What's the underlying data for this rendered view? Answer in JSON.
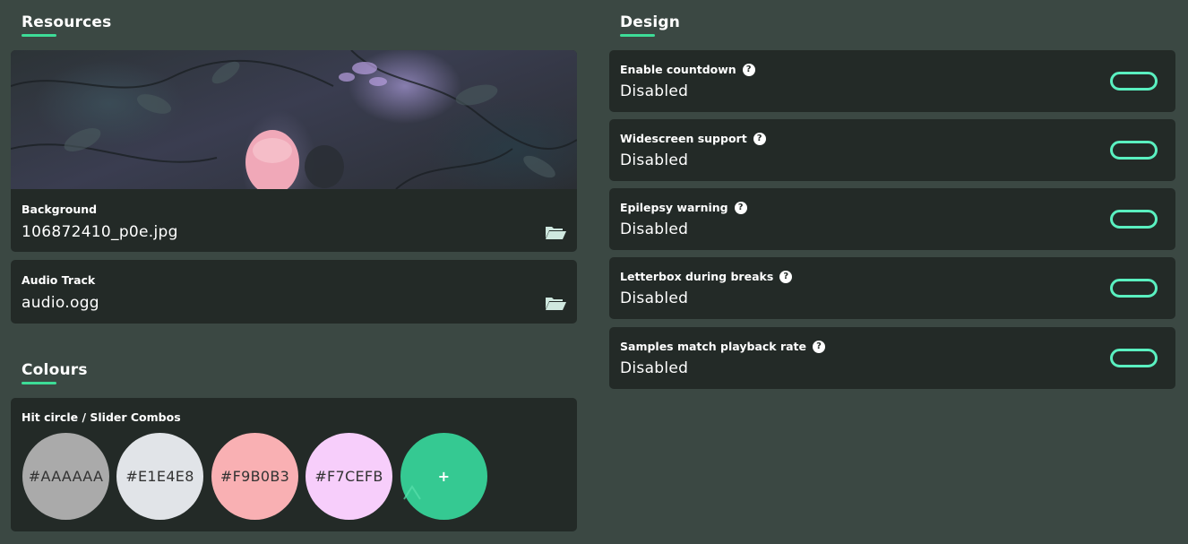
{
  "resources": {
    "title": "Resources",
    "background": {
      "label": "Background",
      "value": "106872410_p0e.jpg",
      "icon": "folder-open-icon"
    },
    "audio": {
      "label": "Audio Track",
      "value": "audio.ogg",
      "icon": "folder-open-icon"
    }
  },
  "colours": {
    "title": "Colours",
    "label": "Hit circle / Slider Combos",
    "swatches": [
      {
        "hex": "#AAAAAA",
        "label": "#AAAAAA"
      },
      {
        "hex": "#E1E4E8",
        "label": "#E1E4E8"
      },
      {
        "hex": "#F9B0B3",
        "label": "#F9B0B3"
      },
      {
        "hex": "#F7CEFB",
        "label": "#F7CEFB"
      }
    ],
    "add_label": "+",
    "add_color": "#35c992"
  },
  "design": {
    "title": "Design",
    "settings": [
      {
        "label": "Enable countdown",
        "value": "Disabled"
      },
      {
        "label": "Widescreen support",
        "value": "Disabled"
      },
      {
        "label": "Epilepsy warning",
        "value": "Disabled"
      },
      {
        "label": "Letterbox during breaks",
        "value": "Disabled"
      },
      {
        "label": "Samples match playback rate",
        "value": "Disabled"
      }
    ]
  },
  "colors": {
    "accent": "#3ddc97",
    "toggle_outline": "#5af0c0",
    "panel": "#232a27",
    "background": "#3b4843"
  }
}
